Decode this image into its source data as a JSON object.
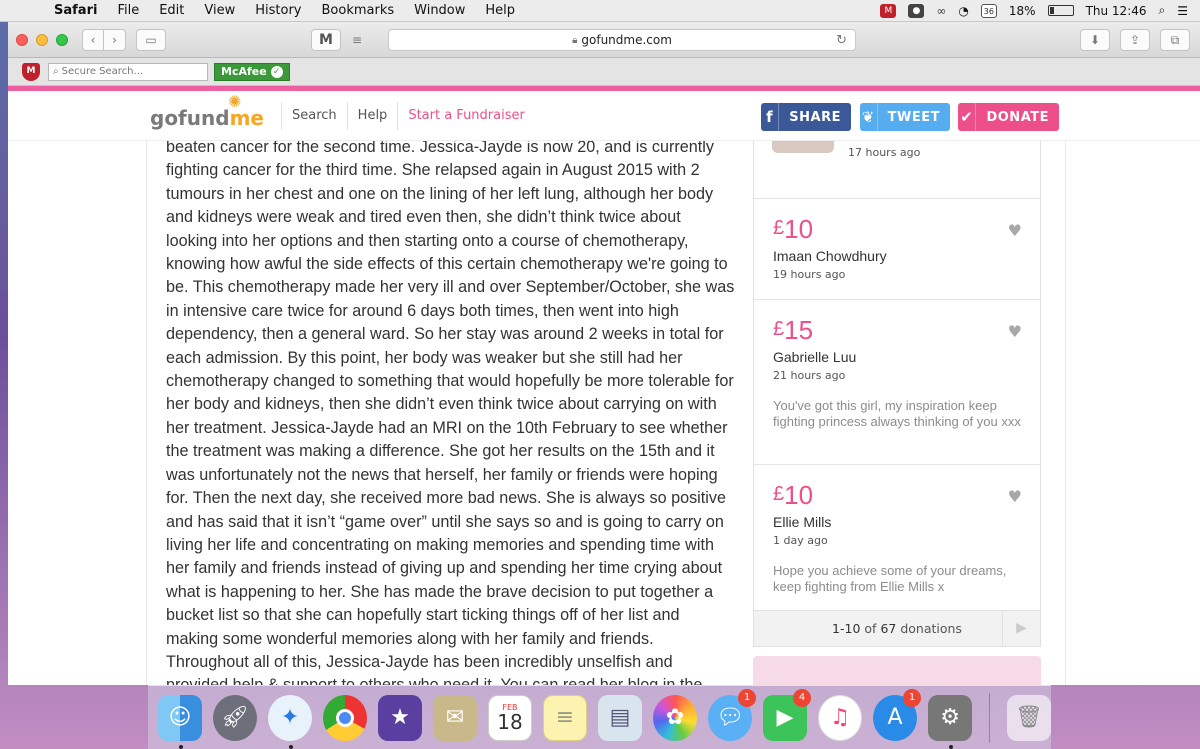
{
  "menubar": {
    "app": "Safari",
    "items": [
      "File",
      "Edit",
      "View",
      "History",
      "Bookmarks",
      "Window",
      "Help"
    ],
    "battery": "18%",
    "battery_level": 0.18,
    "clock": "Thu 12:46"
  },
  "browser": {
    "url": "gofundme.com",
    "search_placeholder": "Secure Search...",
    "mcafee_label": "McAfee",
    "m_label": "M"
  },
  "site": {
    "logo_part1": "gofund",
    "logo_part2": "me",
    "nav": [
      "Search",
      "Help",
      "Start a Fundraiser"
    ],
    "share_label": "SHARE",
    "tweet_label": "TWEET",
    "donate_label": "DONATE"
  },
  "story": {
    "text": "beaten cancer for the second time. Jessica-Jayde is now 20, and is currently fighting cancer for the third time. She relapsed again in August 2015 with 2 tumours in her chest and one on the lining of her left lung, although her body and kidneys were weak and tired even then, she didn’t think twice about looking into her options and then starting onto a course of chemotherapy, knowing how awful the side effects of this certain chemotherapy we're going to be. This chemotherapy made her very ill and over September/October, she was in intensive care twice for around 6 days both times, then went into high dependency, then a general ward. So her stay was around 2 weeks in total for each admission. By this point, her body was weaker but she still had her chemotherapy changed to something that would hopefully be more tolerable for her body and kidneys, then she didn’t even think twice about carrying on with her treatment. Jessica-Jayde had an MRI on the 10th February to see whether the treatment was making a difference. She got her results on the 15th and it was unfortunately not the news that herself, her family or friends were hoping for. Then the next day, she received more bad news. She is always so positive and has said that it isn’t “game over” until she says so and is going to carry on living her life and concentrating on making memories and spending time with her family and friends instead of giving up and spending her time crying about what is happening to her. She has made the brave decision to put together a bucket list so that she can hopefully start ticking things off of her list and making some wonderful memories along with her family and friends. Throughout all of this, Jessica-Jayde has been incredibly unselfish and provided help & support to others who need it. You can read her blog in the"
  },
  "donations": {
    "first_time": "17 hours ago",
    "items": [
      {
        "currency": "£",
        "amount": "10",
        "name": "Imaan Chowdhury",
        "time": "19 hours ago",
        "message": ""
      },
      {
        "currency": "£",
        "amount": "15",
        "name": "Gabrielle Luu",
        "time": "21 hours ago",
        "message": "You've got this girl, my inspiration keep fighting princess always thinking of you xxx"
      },
      {
        "currency": "£",
        "amount": "10",
        "name": "Ellie Mills",
        "time": "1 day ago",
        "message": "Hope you achieve some of your dreams, keep fighting from Ellie Mills x"
      }
    ],
    "pager_range": "1-10",
    "pager_of": "of",
    "pager_total": "67",
    "pager_suffix": "donations"
  },
  "dock": {
    "calendar_month": "FEB",
    "calendar_day": "18",
    "badges": {
      "messages": "1",
      "facetime": "4",
      "appstore": "1"
    }
  }
}
